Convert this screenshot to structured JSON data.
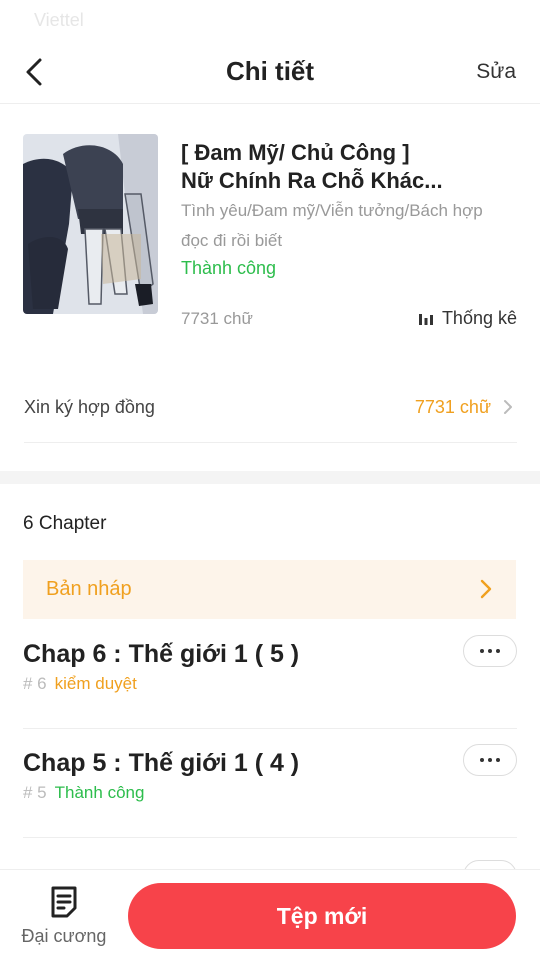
{
  "status_bar": {
    "carrier": "Viettel"
  },
  "nav": {
    "title": "Chi tiết",
    "edit_label": "Sửa"
  },
  "book": {
    "title_line1": "[ Đam Mỹ/ Chủ Công ]",
    "title_line2": "Nữ Chính Ra Chỗ Khác...",
    "genres": "Tình yêu/Đam mỹ/Viễn tưởng/Bách hợp",
    "tagline": "đọc đi rồi biết",
    "status": "Thành công",
    "word_count": "7731 chữ",
    "stats_label": "Thống kê"
  },
  "contract": {
    "label": "Xin ký hợp đồng",
    "value": "7731 chữ"
  },
  "chapters_header": "6 Chapter",
  "drafts_label": "Bản nháp",
  "chapters": [
    {
      "title": "Chap 6 : Thế giới 1 ( 5 )",
      "number": "# 6",
      "status": "kiểm duyệt"
    },
    {
      "title": "Chap 5 : Thế giới 1 ( 4 )",
      "number": "# 5",
      "status": "Thành công"
    }
  ],
  "bottom": {
    "outline_label": "Đại cương",
    "new_label": "Tệp mới"
  },
  "colors": {
    "accent": "#f7434a",
    "success": "#2dbd4c",
    "review": "#f0a01f",
    "draft_bg": "#fdf4ea"
  }
}
